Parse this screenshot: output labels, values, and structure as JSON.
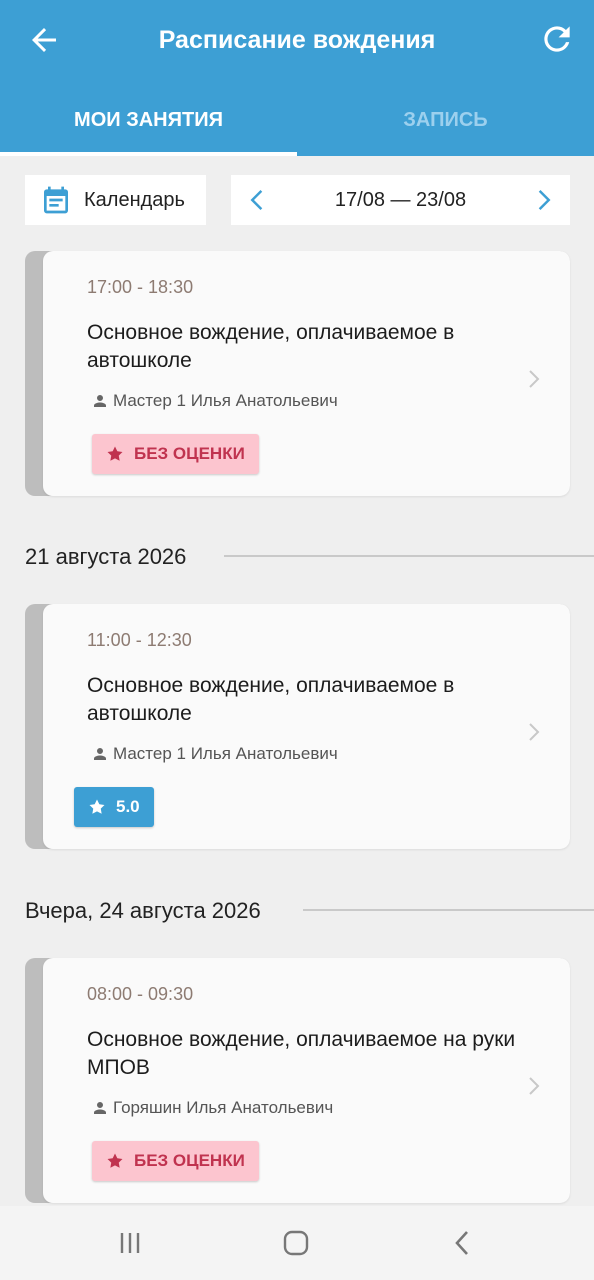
{
  "header": {
    "title": "Расписание вождения"
  },
  "tabs": [
    {
      "label": "Мои занятия",
      "active": true
    },
    {
      "label": "Запись",
      "active": false
    }
  ],
  "toolbar": {
    "calendar_label": "Календарь",
    "week_range": "17/08 — 23/08"
  },
  "dates": {
    "d1": "21 августа 2026",
    "d2": "Вчера, 24 августа 2026"
  },
  "lessons": [
    {
      "time": "17:00 - 18:30",
      "title": "Основное вождение, оплачиваемое в автошколе",
      "instructor": "Мастер 1 Илья Анатольевич",
      "badge": "БЕЗ ОЦЕНКИ"
    },
    {
      "time": "11:00 - 12:30",
      "title": "Основное вождение, оплачиваемое в автошколе",
      "instructor": "Мастер 1 Илья Анатольевич",
      "badge": "5.0"
    },
    {
      "time": "08:00 - 09:30",
      "title": "Основное вождение, оплачиваемое на руки МПОВ",
      "instructor": "Горяшин Илья Анатольевич",
      "badge": "БЕЗ ОЦЕНКИ"
    }
  ],
  "colors": {
    "primary": "#3d9fd4",
    "no_rating_bg": "#fcc5cf",
    "no_rating_text": "#c0334f",
    "card_stripe": "#bdbdbd"
  },
  "icons": {
    "back": "arrow-left-icon",
    "refresh": "refresh-icon",
    "calendar": "calendar-icon",
    "prev": "chevron-left-icon",
    "next": "chevron-right-icon",
    "person": "person-icon",
    "star": "star-icon"
  }
}
